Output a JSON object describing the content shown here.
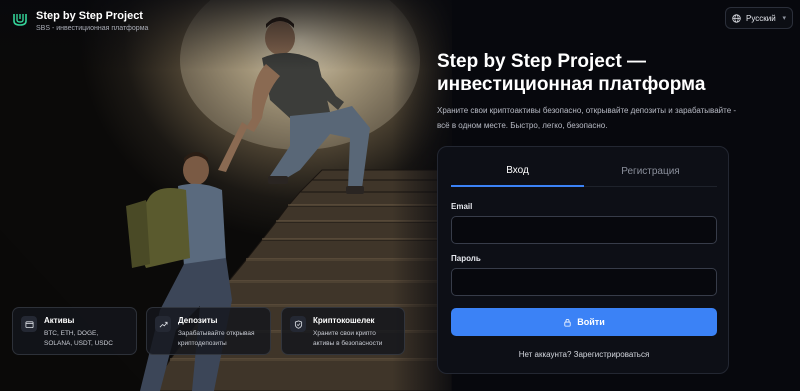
{
  "brand": {
    "title": "Step by Step Project",
    "subtitle": "SBS - инвестиционная платформа"
  },
  "language": {
    "selected": "Русский",
    "icon": "globe-icon"
  },
  "hero": {
    "headline": "Step by Step Project — инвестиционная платформа",
    "subtext": "Храните свои криптоактивы безопасно, открывайте депозиты и зарабатывайте - всё в одном месте. Быстро, легко, безопасно."
  },
  "features": [
    {
      "title": "Активы",
      "description": "BTC, ETH, DOGE, SOLANA, USDT, USDC",
      "icon": "wallet-icon"
    },
    {
      "title": "Депозиты",
      "description": "Зарабатывайте открывая криптодепозиты",
      "icon": "trending-up-icon"
    },
    {
      "title": "Криптокошелек",
      "description": "Храните свои крипто активы в безопасности",
      "icon": "shield-icon"
    }
  ],
  "auth": {
    "tabs": [
      {
        "label": "Вход",
        "active": true
      },
      {
        "label": "Регистрация",
        "active": false
      }
    ],
    "email_label": "Email",
    "email_value": "",
    "password_label": "Пароль",
    "password_value": "",
    "submit_label": "Войти",
    "register_link": "Нет аккаунта? Зарегистрироваться"
  },
  "colors": {
    "accent": "#3b82f6",
    "background": "#07080d",
    "card": "#0d0f16",
    "brand_logo": "#34d399"
  }
}
